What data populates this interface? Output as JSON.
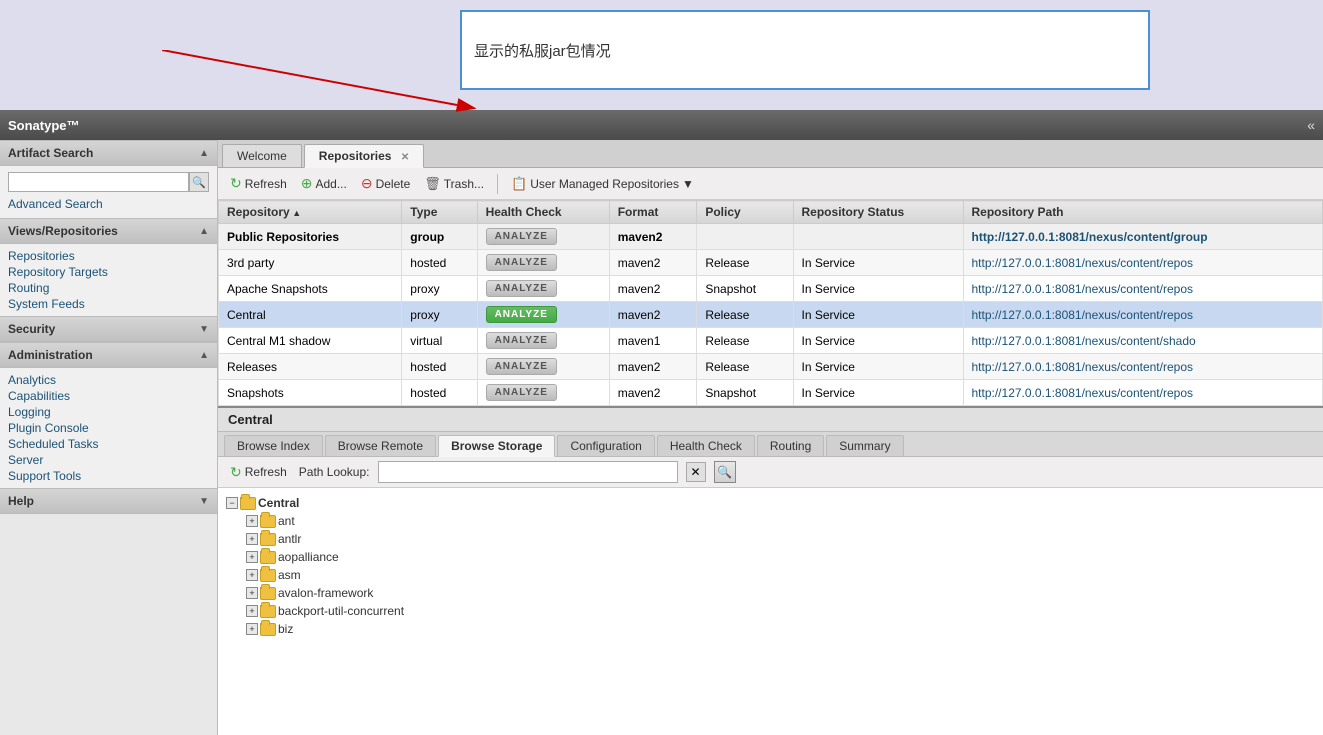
{
  "annotation": {
    "text": "显示的私服jar包情况"
  },
  "header": {
    "title": "Sonatype™"
  },
  "sidebar": {
    "sections": [
      {
        "id": "artifact-search",
        "label": "Artifact Search",
        "expanded": true,
        "children": [
          {
            "type": "search",
            "placeholder": ""
          },
          {
            "type": "link",
            "label": "Advanced Search"
          }
        ]
      },
      {
        "id": "views-repositories",
        "label": "Views/Repositories",
        "expanded": true,
        "children": [
          {
            "type": "link",
            "label": "Repositories"
          },
          {
            "type": "link",
            "label": "Repository Targets"
          },
          {
            "type": "link",
            "label": "Routing"
          },
          {
            "type": "link",
            "label": "System Feeds"
          }
        ]
      },
      {
        "id": "security",
        "label": "Security",
        "expanded": false,
        "children": []
      },
      {
        "id": "administration",
        "label": "Administration",
        "expanded": true,
        "children": [
          {
            "type": "link",
            "label": "Analytics"
          },
          {
            "type": "link",
            "label": "Capabilities"
          },
          {
            "type": "link",
            "label": "Logging"
          },
          {
            "type": "link",
            "label": "Plugin Console"
          },
          {
            "type": "link",
            "label": "Scheduled Tasks"
          },
          {
            "type": "link",
            "label": "Server"
          },
          {
            "type": "link",
            "label": "Support Tools"
          }
        ]
      },
      {
        "id": "help",
        "label": "Help",
        "expanded": false,
        "children": []
      }
    ]
  },
  "tabs": [
    {
      "id": "welcome",
      "label": "Welcome",
      "active": false,
      "closable": false
    },
    {
      "id": "repositories",
      "label": "Repositories",
      "active": true,
      "closable": true
    }
  ],
  "toolbar": {
    "refresh": "Refresh",
    "add": "Add...",
    "delete": "Delete",
    "trash": "Trash...",
    "user_managed": "User Managed Repositories"
  },
  "table": {
    "columns": [
      "Repository",
      "Type",
      "Health Check",
      "Format",
      "Policy",
      "Repository Status",
      "Repository Path"
    ],
    "rows": [
      {
        "name": "Public Repositories",
        "type": "group",
        "healthCheck": "",
        "format": "maven2",
        "policy": "",
        "status": "",
        "path": "http://127.0.0.1:8081/nexus/content/group",
        "isGroup": true,
        "analyzeActive": false
      },
      {
        "name": "3rd party",
        "type": "hosted",
        "healthCheck": "",
        "format": "maven2",
        "policy": "Release",
        "status": "In Service",
        "path": "http://127.0.0.1:8081/nexus/content/repos",
        "isGroup": false,
        "analyzeActive": false
      },
      {
        "name": "Apache Snapshots",
        "type": "proxy",
        "healthCheck": "",
        "format": "maven2",
        "policy": "Snapshot",
        "status": "In Service",
        "path": "http://127.0.0.1:8081/nexus/content/repos",
        "isGroup": false,
        "analyzeActive": false
      },
      {
        "name": "Central",
        "type": "proxy",
        "healthCheck": "",
        "format": "maven2",
        "policy": "Release",
        "status": "In Service",
        "path": "http://127.0.0.1:8081/nexus/content/repos",
        "isGroup": false,
        "analyzeActive": true,
        "selected": true
      },
      {
        "name": "Central M1 shadow",
        "type": "virtual",
        "healthCheck": "",
        "format": "maven1",
        "policy": "Release",
        "status": "In Service",
        "path": "http://127.0.0.1:8081/nexus/content/shado",
        "isGroup": false,
        "analyzeActive": false
      },
      {
        "name": "Releases",
        "type": "hosted",
        "healthCheck": "",
        "format": "maven2",
        "policy": "Release",
        "status": "In Service",
        "path": "http://127.0.0.1:8081/nexus/content/repos",
        "isGroup": false,
        "analyzeActive": false
      },
      {
        "name": "Snapshots",
        "type": "hosted",
        "healthCheck": "",
        "format": "maven2",
        "policy": "Snapshot",
        "status": "In Service",
        "path": "http://127.0.0.1:8081/nexus/content/repos",
        "isGroup": false,
        "analyzeActive": false
      }
    ]
  },
  "bottom_panel": {
    "title": "Central",
    "tabs": [
      {
        "id": "browse-index",
        "label": "Browse Index",
        "active": false
      },
      {
        "id": "browse-remote",
        "label": "Browse Remote",
        "active": false
      },
      {
        "id": "browse-storage",
        "label": "Browse Storage",
        "active": true
      },
      {
        "id": "configuration",
        "label": "Configuration",
        "active": false
      },
      {
        "id": "health-check",
        "label": "Health Check",
        "active": false
      },
      {
        "id": "routing",
        "label": "Routing",
        "active": false
      },
      {
        "id": "summary",
        "label": "Summary",
        "active": false
      }
    ],
    "toolbar": {
      "refresh": "Refresh",
      "path_lookup_label": "Path Lookup:",
      "path_lookup_placeholder": ""
    },
    "tree": {
      "root": "Central",
      "items": [
        "ant",
        "antlr",
        "aopalliance",
        "asm",
        "avalon-framework",
        "backport-util-concurrent",
        "biz"
      ]
    }
  }
}
